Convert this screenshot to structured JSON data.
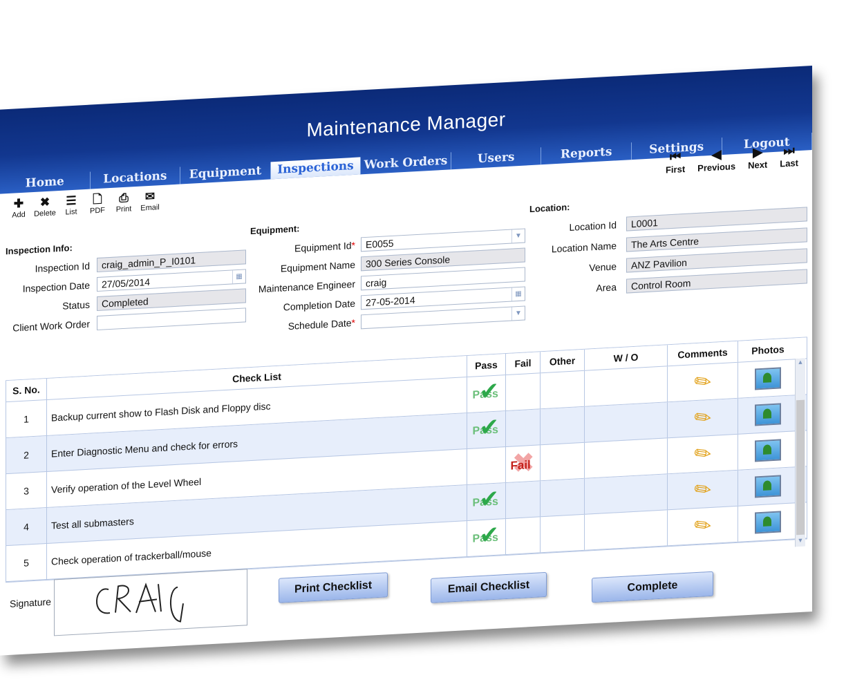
{
  "app": {
    "title": "Maintenance Manager"
  },
  "tabs": [
    "Home",
    "Locations",
    "Equipment",
    "Inspections",
    "Work Orders",
    "Users",
    "Reports",
    "Settings",
    "Logout"
  ],
  "toolbar": {
    "add": "Add",
    "delete": "Delete",
    "list": "List",
    "pdf": "PDF",
    "print": "Print",
    "email": "Email"
  },
  "nav": {
    "first": "First",
    "previous": "Previous",
    "next": "Next",
    "last": "Last"
  },
  "inspection": {
    "section": "Inspection Info:",
    "id_label": "Inspection Id",
    "id_value": "craig_admin_P_I0101",
    "date_label": "Inspection Date",
    "date_value": "27/05/2014",
    "status_label": "Status",
    "status_value": "Completed",
    "wo_label": "Client Work Order",
    "wo_value": ""
  },
  "equipment": {
    "section": "Equipment:",
    "id_label": "Equipment Id",
    "id_value": "E0055",
    "name_label": "Equipment Name",
    "name_value": "300 Series Console",
    "engineer_label": "Maintenance Engineer",
    "engineer_value": "craig",
    "completion_label": "Completion Date",
    "completion_value": "27-05-2014",
    "schedule_label": "Schedule Date",
    "schedule_value": "",
    "req": "*"
  },
  "location": {
    "section": "Location:",
    "id_label": "Location Id",
    "id_value": "L0001",
    "name_label": "Location Name",
    "name_value": "The Arts Centre",
    "venue_label": "Venue",
    "venue_value": "ANZ Pavilion",
    "area_label": "Area",
    "area_value": "Control Room"
  },
  "grid": {
    "headers": {
      "sno": "S. No.",
      "checklist": "Check List",
      "pass": "Pass",
      "fail": "Fail",
      "other": "Other",
      "wo": "W / O",
      "comments": "Comments",
      "photos": "Photos"
    },
    "rows": [
      {
        "no": "1",
        "text": "Backup current show to Flash Disk and Floppy disc",
        "result": "pass"
      },
      {
        "no": "2",
        "text": "Enter Diagnostic Menu and check for errors",
        "result": "pass"
      },
      {
        "no": "3",
        "text": "Verify operation of the Level Wheel",
        "result": "fail"
      },
      {
        "no": "4",
        "text": "Test all submasters",
        "result": "pass"
      },
      {
        "no": "5",
        "text": "Check operation of trackerball/mouse",
        "result": "pass"
      }
    ],
    "pass_text": "Pass",
    "fail_text": "Fail"
  },
  "signature": {
    "label": "Signature",
    "value": "CRAIG"
  },
  "buttons": {
    "print": "Print Checklist",
    "email": "Email Checklist",
    "complete": "Complete"
  }
}
